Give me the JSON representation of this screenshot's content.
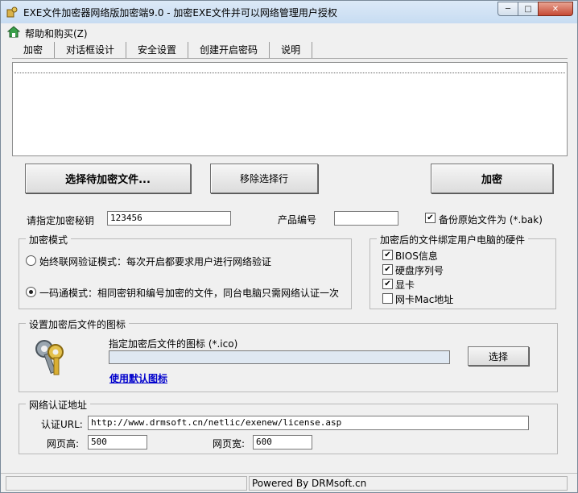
{
  "window": {
    "title": "EXE文件加密器网络版加密端9.0 - 加密EXE文件并可以网络管理用户授权",
    "icon": "app-icon",
    "controls": {
      "minimize": "─",
      "maximize": "□",
      "close": "✕"
    }
  },
  "menu": {
    "help": "帮助和购买(Z)"
  },
  "tabs": [
    "加密",
    "对话框设计",
    "安全设置",
    "创建开启密码",
    "说明"
  ],
  "actions": {
    "select_files": "选择待加密文件...",
    "remove_selected": "移除选择行",
    "encrypt": "加密"
  },
  "key_row": {
    "key_label": "请指定加密秘钥",
    "key_value": "123456",
    "product_label": "产品编号",
    "product_value": "",
    "backup_label": "备份原始文件为 (*.bak)",
    "backup_checked": true
  },
  "mode_group": {
    "title": "加密模式",
    "options": [
      {
        "label": "始终联网验证模式：每次开启都要求用户进行网络验证",
        "selected": false
      },
      {
        "label": "一码通模式：相同密钥和编号加密的文件，同台电脑只需网络认证一次",
        "selected": true
      }
    ]
  },
  "hardware_group": {
    "title": "加密后的文件绑定用户电脑的硬件",
    "items": [
      {
        "label": "BIOS信息",
        "checked": true
      },
      {
        "label": "硬盘序列号",
        "checked": true
      },
      {
        "label": "显卡",
        "checked": true
      },
      {
        "label": "网卡Mac地址",
        "checked": false
      }
    ]
  },
  "icon_group": {
    "title": "设置加密后文件的图标",
    "prompt": "指定加密后文件的图标 (*.ico)",
    "path_value": "",
    "choose_button": "选择",
    "default_link": "使用默认图标"
  },
  "network_group": {
    "title": "网络认证地址",
    "url_label": "认证URL:",
    "url_value": "http://www.drmsoft.cn/netlic/exenew/license.asp",
    "height_label": "网页高:",
    "height_value": "500",
    "width_label": "网页宽:",
    "width_value": "600"
  },
  "status": {
    "text": "Powered By DRMsoft.cn"
  }
}
